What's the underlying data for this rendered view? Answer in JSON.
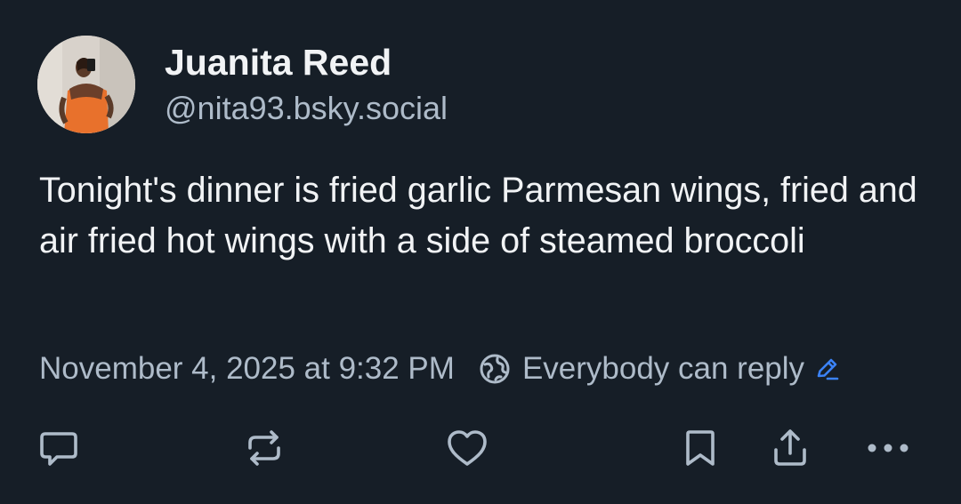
{
  "post": {
    "author": {
      "display_name": "Juanita Reed",
      "handle": "@nita93.bsky.social"
    },
    "text": "Tonight's dinner is fried garlic Parmesan wings, fried and air fried hot wings with a side of steamed broccoli",
    "timestamp": "November 4, 2025 at 9:32 PM",
    "reply_setting": "Everybody can reply"
  },
  "icons": {
    "avatar": "avatar",
    "globe": "globe-icon",
    "edit": "pencil-icon",
    "reply": "speech-bubble-icon",
    "repost": "repost-icon",
    "like": "heart-icon",
    "bookmark": "bookmark-icon",
    "share": "share-icon",
    "more": "more-dots-icon"
  },
  "colors": {
    "background": "#161e27",
    "text_primary": "#f1f3f5",
    "text_secondary": "#aebbc9",
    "accent": "#3b82f6"
  }
}
